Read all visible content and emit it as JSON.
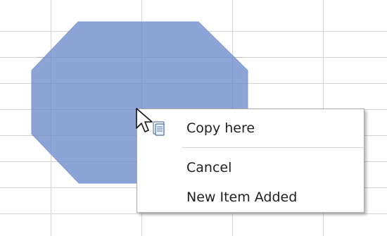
{
  "context_menu": {
    "items": [
      {
        "label": "Copy here"
      },
      {
        "label": "Cancel"
      },
      {
        "label": "New Item Added"
      }
    ]
  },
  "icons": {
    "cursor": "copy-cursor-icon"
  },
  "colors": {
    "shape_fill": "#8da4d6",
    "shape_stroke": "#7f98cf",
    "grid_line": "#d3d3d3"
  }
}
